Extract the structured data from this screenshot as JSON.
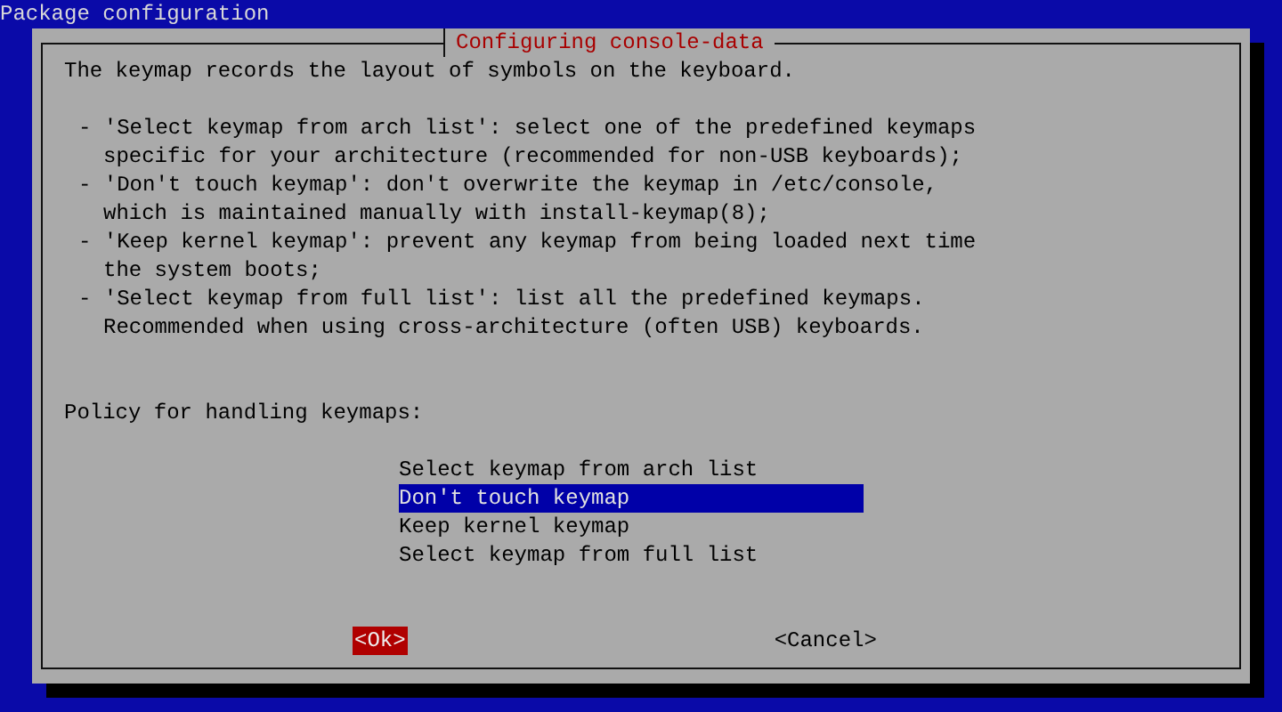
{
  "screen_title": "Package configuration",
  "dialog": {
    "title": "Configuring console-data",
    "intro": "The keymap records the layout of symbols on the keyboard.",
    "bullets": [
      {
        "lines": [
          "- 'Select keymap from arch list': select one of the predefined keymaps",
          "specific for your architecture (recommended for non-USB keyboards);"
        ]
      },
      {
        "lines": [
          "- 'Don't touch keymap': don't overwrite the keymap in /etc/console,",
          "which is maintained manually with install-keymap(8);"
        ]
      },
      {
        "lines": [
          "- 'Keep kernel keymap': prevent any keymap from being loaded next time",
          "the system boots;"
        ]
      },
      {
        "lines": [
          "- 'Select keymap from full list': list all the predefined keymaps.",
          "Recommended when using cross-architecture (often USB) keyboards."
        ]
      }
    ],
    "prompt": "Policy for handling keymaps:",
    "options": [
      {
        "label": "Select keymap from arch list",
        "selected": false
      },
      {
        "label": "Don't touch keymap",
        "selected": true
      },
      {
        "label": "Keep kernel keymap",
        "selected": false
      },
      {
        "label": "Select keymap from full list",
        "selected": false
      }
    ],
    "buttons": [
      {
        "label": "<Ok>",
        "selected": true
      },
      {
        "label": "<Cancel>",
        "selected": false
      }
    ]
  }
}
